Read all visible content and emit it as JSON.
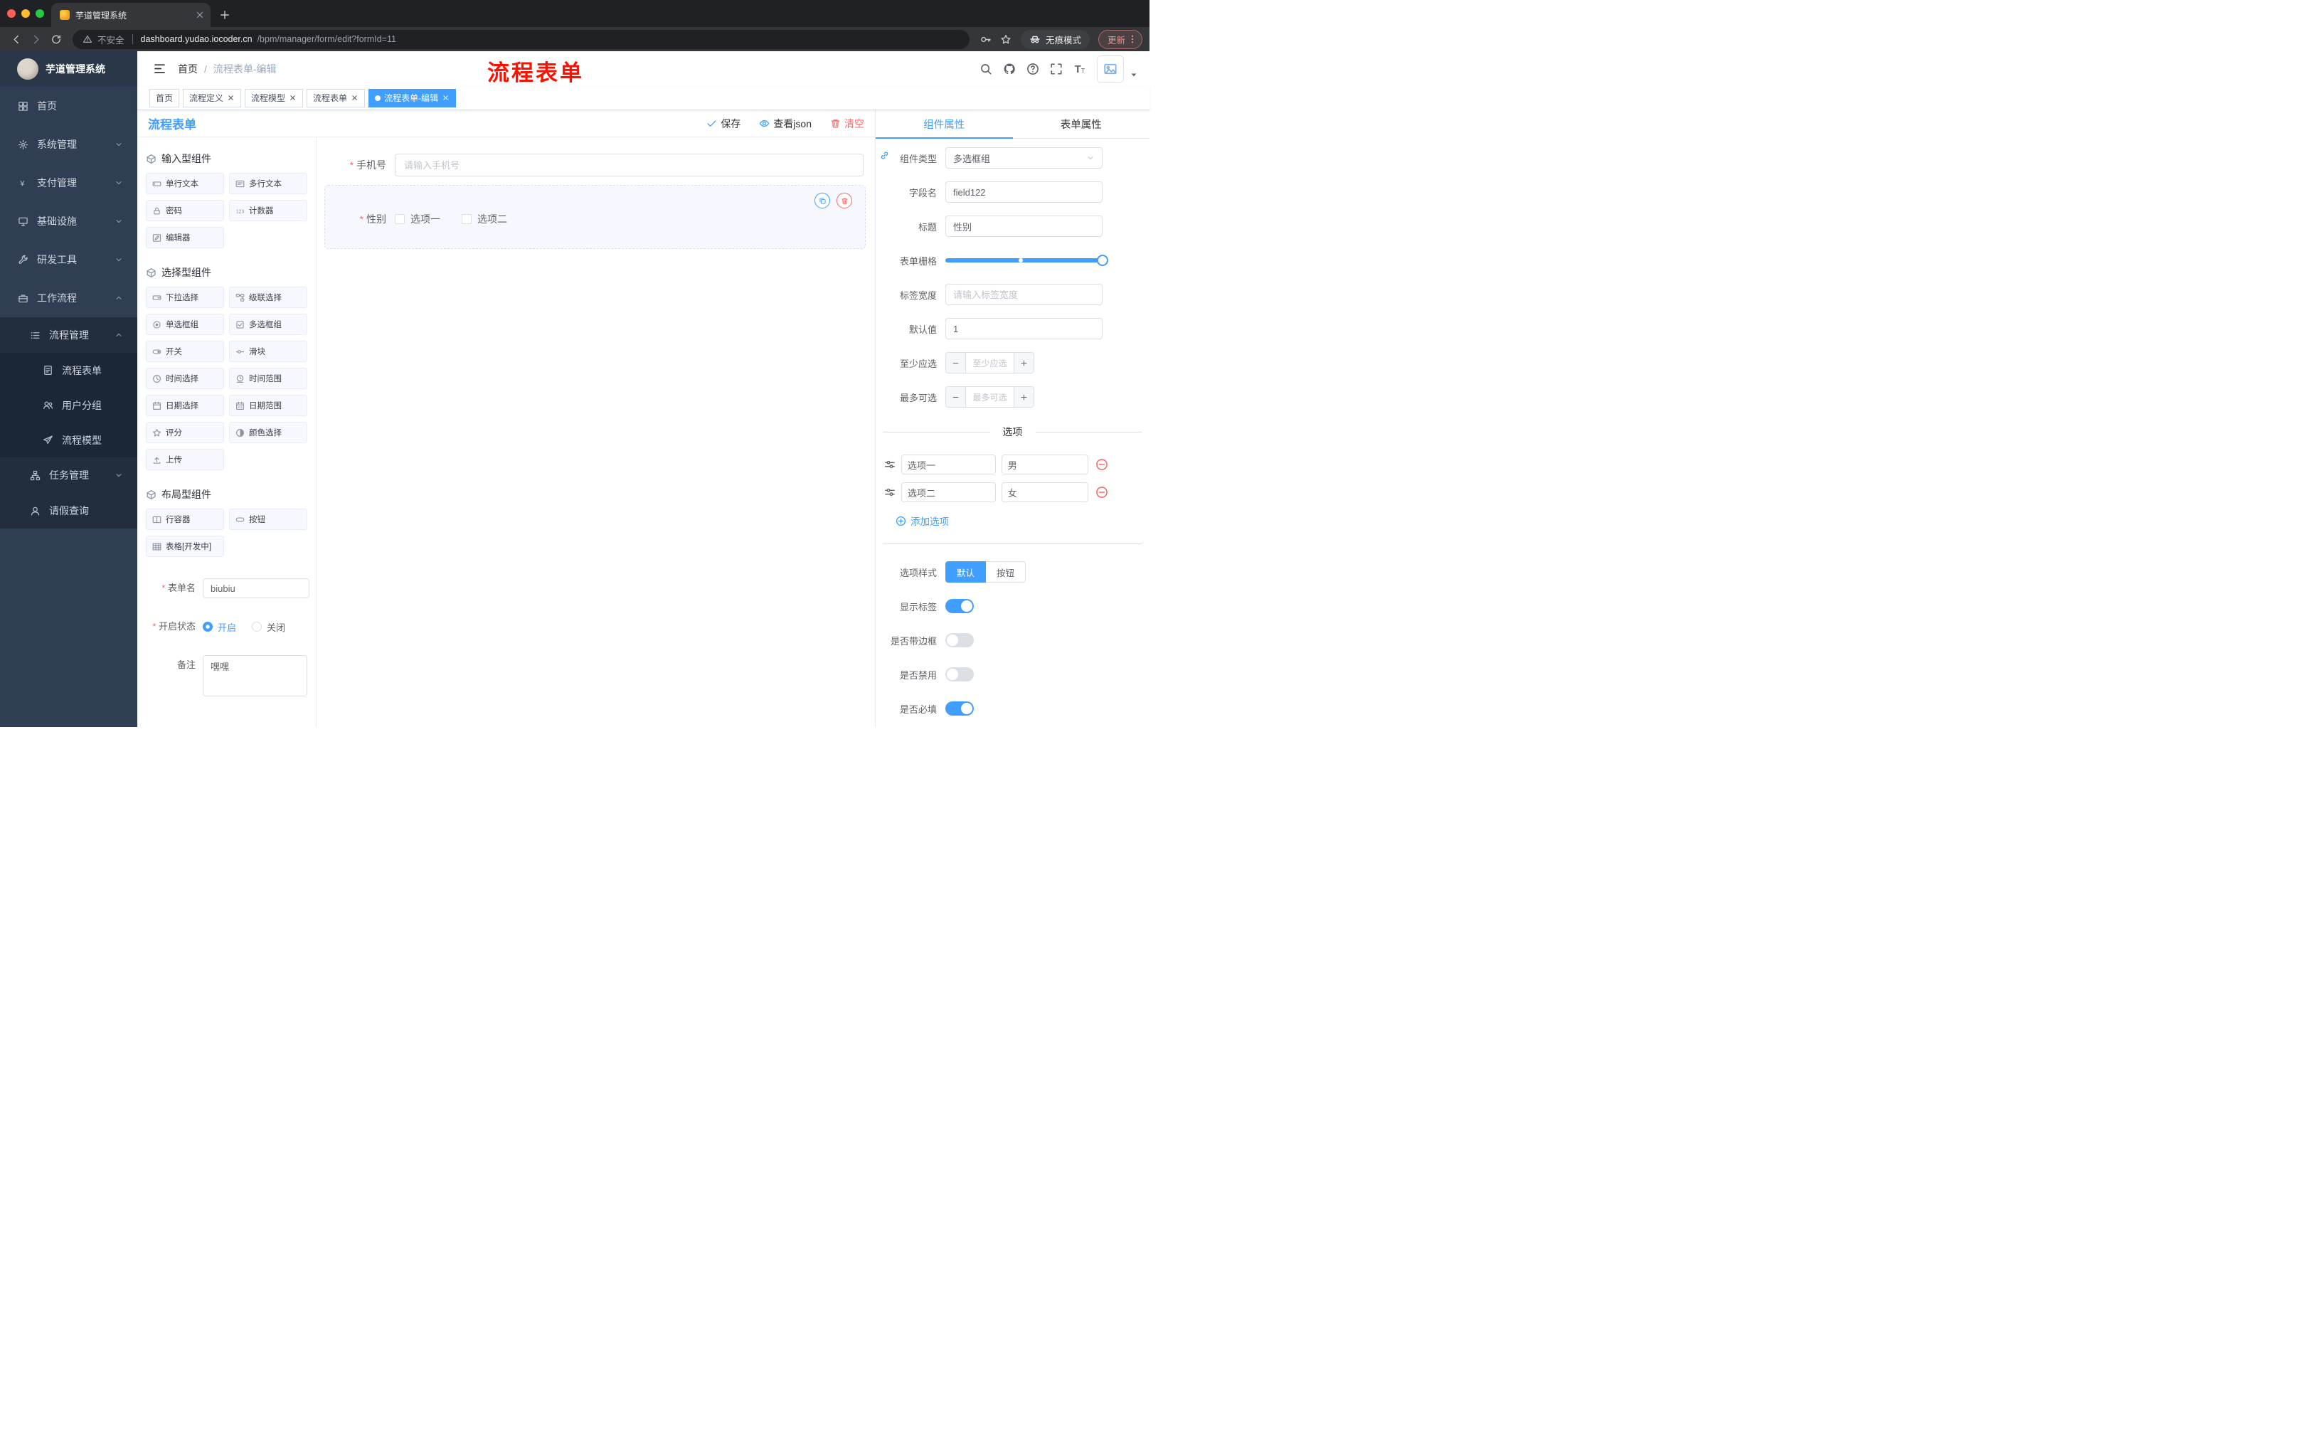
{
  "colors": {
    "primary": "#409eff",
    "danger": "#f56c6c",
    "annotation": "#ff0000"
  },
  "browser": {
    "tab_title": "芋道管理系统",
    "security_label": "不安全",
    "url_host": "dashboard.yudao.iocoder.cn",
    "url_path": "/bpm/manager/form/edit?formId=11",
    "incognito_label": "无痕模式",
    "update_label": "更新"
  },
  "header": {
    "logo_title": "芋道管理系统",
    "breadcrumb_home": "首页",
    "breadcrumb_current": "流程表单-编辑",
    "annotation": "流程表单"
  },
  "sidebar": {
    "items": [
      {
        "label": "首页",
        "icon": "dashboard-icon"
      },
      {
        "label": "系统管理",
        "icon": "gear-icon"
      },
      {
        "label": "支付管理",
        "icon": "yen-icon"
      },
      {
        "label": "基础设施",
        "icon": "infra-icon"
      },
      {
        "label": "研发工具",
        "icon": "tools-icon"
      },
      {
        "label": "工作流程",
        "icon": "workflow-icon"
      },
      {
        "label": "流程管理",
        "icon": "process-icon"
      },
      {
        "label": "流程表单",
        "icon": "form-icon"
      },
      {
        "label": "用户分组",
        "icon": "user-group-icon"
      },
      {
        "label": "流程模型",
        "icon": "model-icon"
      },
      {
        "label": "任务管理",
        "icon": "task-icon"
      },
      {
        "label": "请假查询",
        "icon": "leave-icon"
      }
    ]
  },
  "tags": [
    {
      "label": "首页"
    },
    {
      "label": "流程定义"
    },
    {
      "label": "流程模型"
    },
    {
      "label": "流程表单"
    },
    {
      "label": "流程表单-编辑"
    }
  ],
  "designer": {
    "title": "流程表单",
    "actions": {
      "save": "保存",
      "view_json": "查看json",
      "clear": "清空"
    },
    "palette": {
      "sections": [
        {
          "title": "输入型组件",
          "items": [
            {
              "label": "单行文本",
              "icon": "input-icon"
            },
            {
              "label": "多行文本",
              "icon": "textarea-icon"
            },
            {
              "label": "密码",
              "icon": "password-icon"
            },
            {
              "label": "计数器",
              "icon": "counter-icon"
            },
            {
              "label": "编辑器",
              "icon": "editor-icon"
            }
          ]
        },
        {
          "title": "选择型组件",
          "items": [
            {
              "label": "下拉选择",
              "icon": "select-icon"
            },
            {
              "label": "级联选择",
              "icon": "cascader-icon"
            },
            {
              "label": "单选框组",
              "icon": "radio-icon"
            },
            {
              "label": "多选框组",
              "icon": "checkbox-icon"
            },
            {
              "label": "开关",
              "icon": "switch-icon"
            },
            {
              "label": "滑块",
              "icon": "slider-icon"
            },
            {
              "label": "时间选择",
              "icon": "time-icon"
            },
            {
              "label": "时间范围",
              "icon": "time-range-icon"
            },
            {
              "label": "日期选择",
              "icon": "date-icon"
            },
            {
              "label": "日期范围",
              "icon": "date-range-icon"
            },
            {
              "label": "评分",
              "icon": "rate-icon"
            },
            {
              "label": "颜色选择",
              "icon": "color-icon"
            },
            {
              "label": "上传",
              "icon": "upload-icon"
            }
          ]
        },
        {
          "title": "布局型组件",
          "items": [
            {
              "label": "行容器",
              "icon": "row-icon"
            },
            {
              "label": "按钮",
              "icon": "button-icon"
            },
            {
              "label": "表格[开发中]",
              "icon": "table-icon"
            }
          ]
        }
      ]
    },
    "meta_form": {
      "form_name_label": "表单名",
      "form_name_value": "biubiu",
      "status_label": "开启状态",
      "status_on": "开启",
      "status_off": "关闭",
      "remark_label": "备注",
      "remark_value": "嘿嘿"
    },
    "canvas": {
      "fields": [
        {
          "label": "手机号",
          "placeholder": "请输入手机号"
        },
        {
          "label": "性别",
          "options": [
            "选项一",
            "选项二"
          ]
        }
      ]
    },
    "props": {
      "tab_component": "组件属性",
      "tab_form": "表单属性",
      "component_type_label": "组件类型",
      "component_type_value": "多选框组",
      "field_name_label": "字段名",
      "field_name_value": "field122",
      "title_label": "标题",
      "title_value": "性别",
      "grid_label": "表单栅格",
      "label_width_label": "标签宽度",
      "label_width_placeholder": "请输入标签宽度",
      "default_label": "默认值",
      "default_value": "1",
      "min_label": "至少应选",
      "min_placeholder": "至少应选",
      "max_label": "最多可选",
      "max_placeholder": "最多可选",
      "options_divider": "选项",
      "options": [
        {
          "label": "选项一",
          "value": "男"
        },
        {
          "label": "选项二",
          "value": "女"
        }
      ],
      "add_option": "添加选项",
      "style_label": "选项样式",
      "style_default": "默认",
      "style_button": "按钮",
      "switches": [
        {
          "label": "显示标签",
          "on": true
        },
        {
          "label": "是否带边框",
          "on": false
        },
        {
          "label": "是否禁用",
          "on": false
        },
        {
          "label": "是否必填",
          "on": true
        }
      ]
    }
  }
}
